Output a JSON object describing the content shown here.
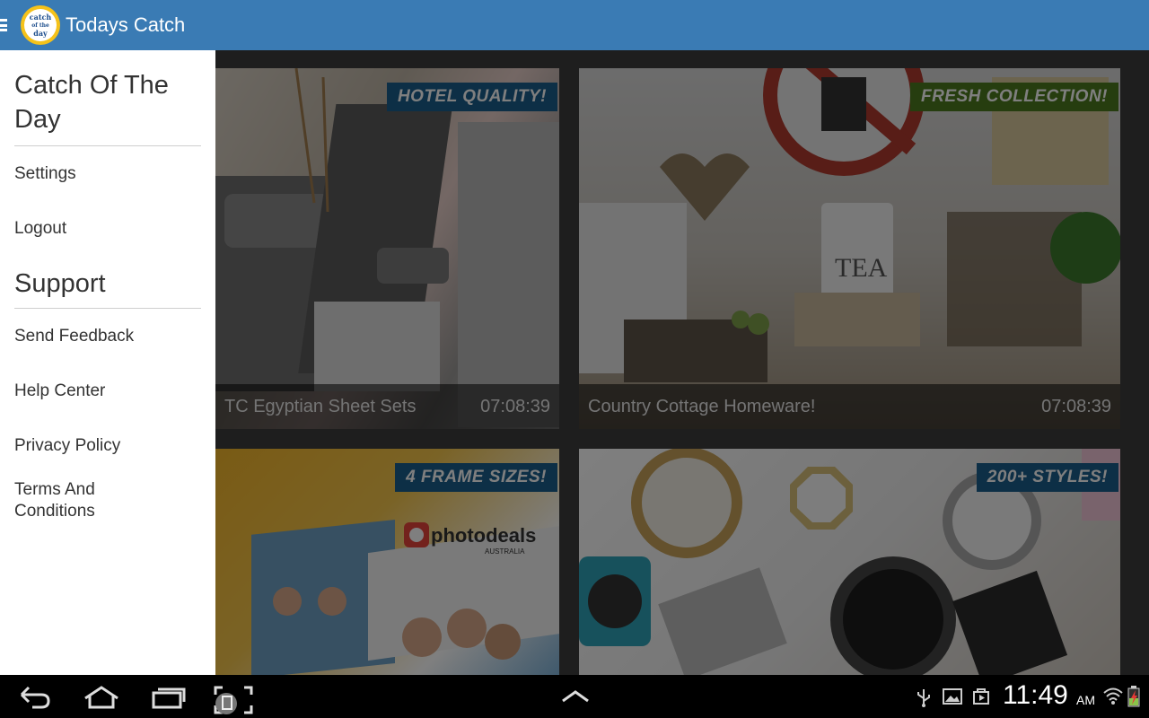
{
  "actionbar": {
    "title": "Todays Catch",
    "logo_text_1": "catch",
    "logo_text_2": "of the",
    "logo_text_3": "day"
  },
  "drawer": {
    "account_heading": "Catch Of The Day",
    "settings_label": "Settings",
    "logout_label": "Logout",
    "support_heading": "Support",
    "send_feedback_label": "Send Feedback",
    "help_center_label": "Help Center",
    "privacy_policy_label": "Privacy Policy",
    "terms_label": "Terms And Conditions"
  },
  "deals": [
    {
      "badge": "HOTEL QUALITY!",
      "title": "TC Egyptian Sheet Sets",
      "timer": "07:08:39",
      "badge_color": "#1b5f8c"
    },
    {
      "badge": "FRESH COLLECTION!",
      "title": "Country Cottage Homeware!",
      "timer": "07:08:39",
      "badge_color": "#4d7a1e"
    },
    {
      "badge": "4 FRAME SIZES!",
      "title": "",
      "timer": "",
      "badge_color": "#1b5f8c",
      "brand": "photodeals",
      "brand_sub": "AUSTRALIA"
    },
    {
      "badge": "200+ STYLES!",
      "title": "",
      "timer": "",
      "badge_color": "#1b5f8c"
    }
  ],
  "system": {
    "time": "11:49",
    "ampm": "AM"
  },
  "colors": {
    "actionbar": "#3a7bb4",
    "drawer": "#ffffff"
  }
}
